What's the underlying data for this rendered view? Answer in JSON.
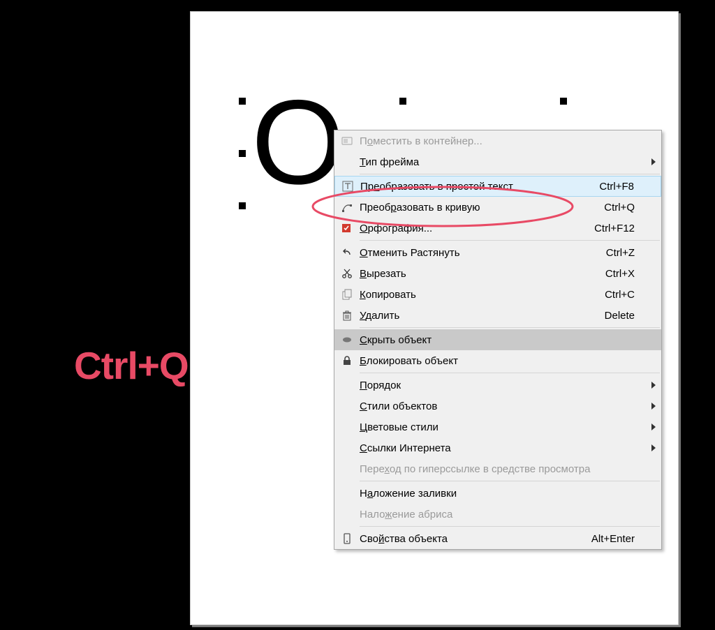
{
  "canvas_letter": "O",
  "callout": "Ctrl+Q",
  "colors": {
    "callout": "#e84a65",
    "highlight_bg": "#def0fb",
    "highlight_border": "#a6d6f1",
    "hover_bg": "#c9c9c9"
  },
  "menu": {
    "items": [
      {
        "label_pre": "П",
        "mn": "о",
        "label_post": "местить в контейнер...",
        "shortcut": "",
        "disabled": true,
        "icon": "container-icon"
      },
      {
        "label_pre": "",
        "mn": "Т",
        "label_post": "ип фрейма",
        "shortcut": "",
        "submenu": true
      },
      {
        "sep": true
      },
      {
        "label_pre": "Пр",
        "mn": "е",
        "label_post": "образовать в простой текст",
        "shortcut": "Ctrl+F8",
        "highlight": true,
        "icon": "text-frame-icon"
      },
      {
        "label_pre": "Преоб",
        "mn": "р",
        "label_post": "азовать в кривую",
        "shortcut": "Ctrl+Q",
        "icon": "curve-icon"
      },
      {
        "label_pre": "",
        "mn": "О",
        "label_post": "рфография...",
        "shortcut": "Ctrl+F12",
        "icon": "spellcheck-icon"
      },
      {
        "sep": true
      },
      {
        "label_pre": "",
        "mn": "О",
        "label_post": "тменить Растянуть",
        "shortcut": "Ctrl+Z",
        "icon": "undo-icon"
      },
      {
        "label_pre": "",
        "mn": "В",
        "label_post": "ырезать",
        "shortcut": "Ctrl+X",
        "icon": "cut-icon"
      },
      {
        "label_pre": "",
        "mn": "К",
        "label_post": "опировать",
        "shortcut": "Ctrl+C",
        "icon": "copy-icon"
      },
      {
        "label_pre": "",
        "mn": "У",
        "label_post": "далить",
        "shortcut": "Delete",
        "icon": "delete-icon"
      },
      {
        "sep": true
      },
      {
        "label_pre": "",
        "mn": "С",
        "label_post": "крыть объект",
        "shortcut": "",
        "icon": "hide-icon",
        "hover": true
      },
      {
        "label_pre": "",
        "mn": "Б",
        "label_post": "локировать объект",
        "shortcut": "",
        "icon": "lock-icon"
      },
      {
        "sep": true
      },
      {
        "label_pre": "",
        "mn": "П",
        "label_post": "орядок",
        "submenu": true
      },
      {
        "label_pre": "",
        "mn": "С",
        "label_post": "тили объектов",
        "submenu": true
      },
      {
        "label_pre": "",
        "mn": "Ц",
        "label_post": "ветовые стили",
        "submenu": true
      },
      {
        "label_pre": "",
        "mn": "С",
        "label_post": "сылки Интернета",
        "submenu": true
      },
      {
        "label_pre": "Пере",
        "mn": "х",
        "label_post": "од по гиперссылке в средстве просмотра",
        "disabled": true
      },
      {
        "sep": true
      },
      {
        "label_pre": "Н",
        "mn": "а",
        "label_post": "ложение заливки"
      },
      {
        "label_pre": "Нало",
        "mn": "ж",
        "label_post": "ение абриса",
        "disabled": true
      },
      {
        "sep": true
      },
      {
        "label_pre": "Сво",
        "mn": "й",
        "label_post": "ства объекта",
        "shortcut": "Alt+Enter",
        "icon": "properties-icon"
      }
    ]
  }
}
